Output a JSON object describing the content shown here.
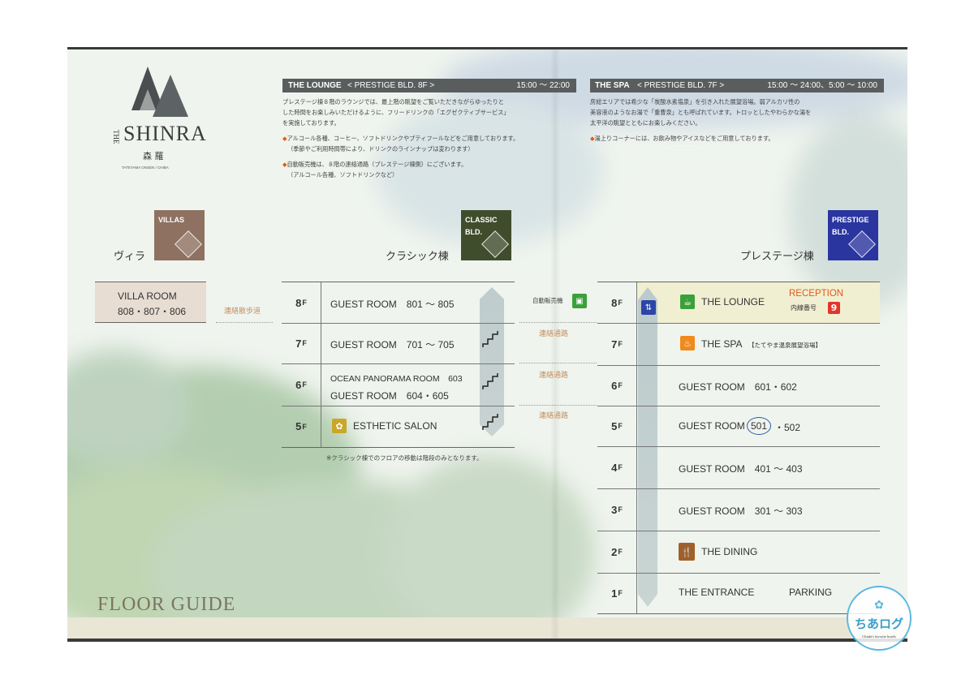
{
  "brand": {
    "the": "THE",
    "name": "SHINRA",
    "kanji": "森 羅",
    "sub": "TATEYAMA ONSEN / CHIBA"
  },
  "footer": {
    "title": "FLOOR GUIDE"
  },
  "lounge": {
    "label": "THE LOUNGE",
    "bld": "< PRESTIGE BLD. 8F >",
    "hours": "15:00 ～ 22:00",
    "lines": [
      "プレステージ棟８階のラウンジでは、最上階の眺望をご覧いただきながらゆったりと",
      "した時間をお楽しみいただけるように、フリードリンクの「エグゼクティブサービス」",
      "を実施しております。"
    ],
    "note1": "アルコール各種、コーヒー、ソフトドリンクやプティフールなどをご用意しております。",
    "note1b": "（季節やご利用時間帯により、ドリンクのラインナップは変わります）",
    "note2": "自動販売機は、８階の連絡通路（プレステージ棟側）にございます。",
    "note2b": "（アルコール各種、ソフトドリンクなど）"
  },
  "spa": {
    "label": "THE SPA",
    "bld": "< PRESTIGE BLD. 7F >",
    "hours": "15:00 ～ 24:00、5:00 ～ 10:00",
    "lines": [
      "房総エリアでは希少な「炭酸水素塩泉」を引き入れた展望浴場。弱アルカリ性の",
      "美容液のようなお湯で「重曹泉」とも呼ばれています。トロッとしたやわらかな湯を",
      "太平洋の眺望とともにお楽しみください。"
    ],
    "note1": "湯上りコーナーには、お飲み物やアイスなどをご用意しております。"
  },
  "buildings": {
    "villas": {
      "tag": "VILLAS",
      "name": "ヴィラ",
      "color": "#8e7160"
    },
    "classic": {
      "tag1": "CLASSIC",
      "tag2": "BLD.",
      "name": "クラシック棟",
      "color": "#3f4d2c"
    },
    "prestige": {
      "tag1": "PRESTIGE",
      "tag2": "BLD.",
      "name": "プレステージ棟",
      "color": "#2b35a0"
    }
  },
  "villa_room": {
    "line1": "VILLA ROOM",
    "line2": "808・807・806",
    "walkway": "連絡散歩道"
  },
  "classic_floors": [
    {
      "num": "8",
      "unit": "F",
      "text": "GUEST ROOM　801 ～ 805"
    },
    {
      "num": "7",
      "unit": "F",
      "text": "GUEST ROOM　701 ～ 705"
    },
    {
      "num": "6",
      "unit": "F",
      "text": "OCEAN PANORAMA ROOM　603",
      "text2": "GUEST ROOM　604・605"
    },
    {
      "num": "5",
      "unit": "F",
      "text": "ESTHETIC SALON"
    }
  ],
  "classic_note": "※クラシック棟でのフロアの移動は階段のみとなります。",
  "connectors": {
    "vending": "自動販売機",
    "passage": "連絡通路"
  },
  "prestige_floors": [
    {
      "num": "8",
      "unit": "F",
      "text": "THE LOUNGE",
      "reception": "RECEPTION",
      "ext_label": "内線番号",
      "ext": "9"
    },
    {
      "num": "7",
      "unit": "F",
      "text": "THE SPA",
      "sub": "【たてやま温泉展望浴場】"
    },
    {
      "num": "6",
      "unit": "F",
      "text": "GUEST ROOM　601・602"
    },
    {
      "num": "5",
      "unit": "F",
      "text": "GUEST ROOM",
      "room_a": "501",
      "room_b": "・502"
    },
    {
      "num": "4",
      "unit": "F",
      "text": "GUEST ROOM　401 ～ 403"
    },
    {
      "num": "3",
      "unit": "F",
      "text": "GUEST ROOM　301 ～ 303"
    },
    {
      "num": "2",
      "unit": "F",
      "text": "THE DINING"
    },
    {
      "num": "1",
      "unit": "F",
      "text": "THE ENTRANCE",
      "text2": "PARKING"
    }
  ],
  "watermark": {
    "text": "ちあログ",
    "sub": "Chiaki's favorite hotels"
  }
}
